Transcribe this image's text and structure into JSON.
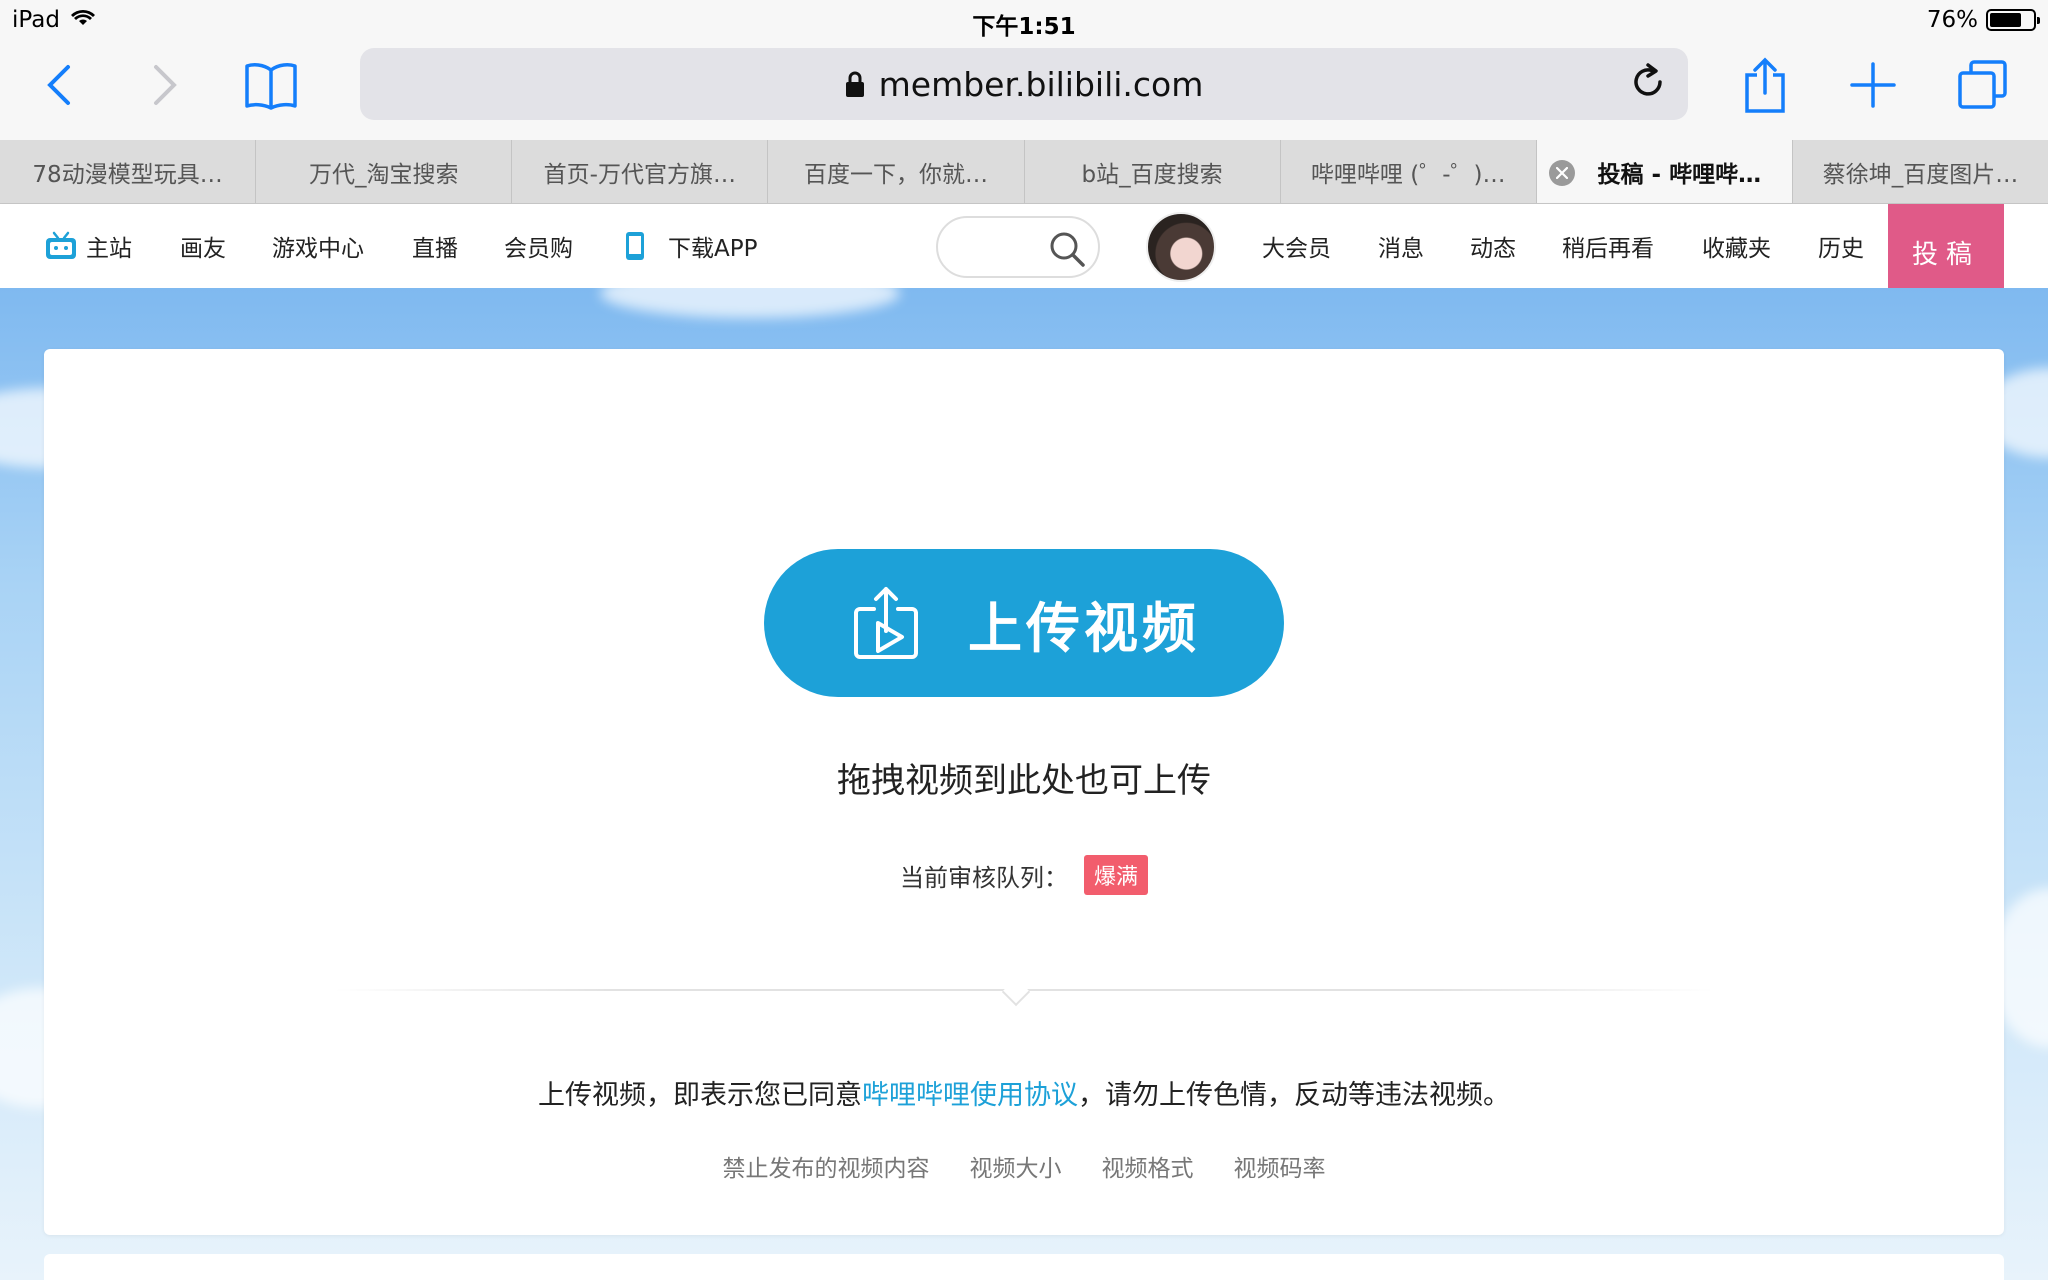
{
  "status_bar": {
    "device": "iPad",
    "time": "下午1:51",
    "battery": "76%",
    "battery_level": 0.76
  },
  "browser": {
    "url": "member.bilibili.com",
    "tabs": [
      {
        "label": "78动漫模型玩具…"
      },
      {
        "label": "万代_淘宝搜索"
      },
      {
        "label": "首页-万代官方旗…"
      },
      {
        "label": "百度一下，你就…"
      },
      {
        "label": "b站_百度搜索"
      },
      {
        "label": "哔哩哔哩 (゜-゜)…"
      },
      {
        "label": "投稿 - 哔哩哔…"
      },
      {
        "label": "蔡徐坤_百度图片…"
      }
    ],
    "active_tab": 6
  },
  "site_nav": {
    "left": [
      "主站",
      "画友",
      "游戏中心",
      "直播",
      "会员购",
      "下载APP"
    ],
    "right": [
      "大会员",
      "消息",
      "动态",
      "稍后再看",
      "收藏夹",
      "历史"
    ],
    "upload": "投稿"
  },
  "main": {
    "upload_button": "上传视频",
    "drag_hint": "拖拽视频到此处也可上传",
    "queue_label": "当前审核队列：",
    "queue_status": "爆满",
    "agreement_prefix": "上传视频，即表示您已同意",
    "agreement_link": "哔哩哔哩使用协议",
    "agreement_suffix": "，请勿上传色情，反动等违法视频。",
    "links": [
      "禁止发布的视频内容",
      "视频大小",
      "视频格式",
      "视频码率"
    ]
  },
  "colors": {
    "accent": "#1da1d8",
    "upload_pink": "#e05a88",
    "badge_red": "#f25d6d",
    "ios_blue": "#147efb"
  }
}
